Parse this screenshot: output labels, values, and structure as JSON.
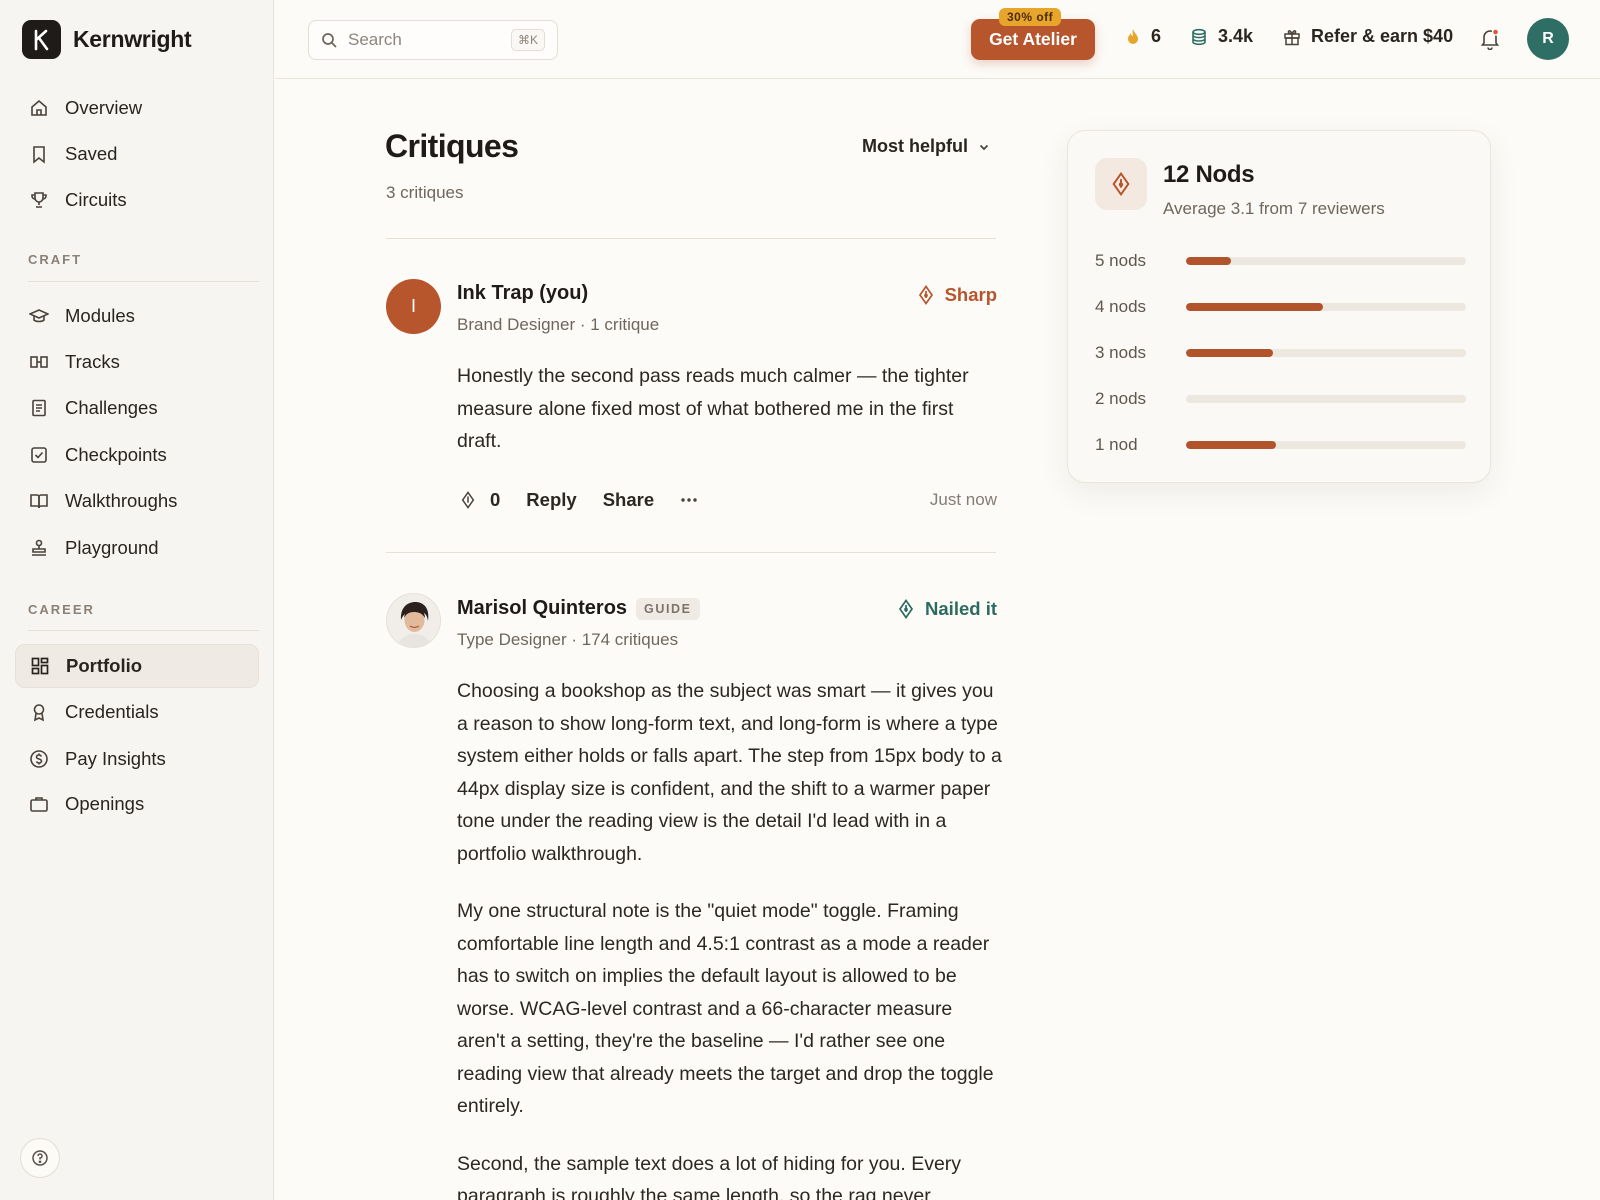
{
  "brand": {
    "name": "Kernwright",
    "logo_letter": "K"
  },
  "sidebar": {
    "top_items": [
      {
        "label": "Overview",
        "icon": "home-icon"
      },
      {
        "label": "Saved",
        "icon": "bookmark-icon"
      },
      {
        "label": "Circuits",
        "icon": "trophy-icon"
      }
    ],
    "sections": [
      {
        "title": "CRAFT",
        "items": [
          {
            "label": "Modules",
            "icon": "graduation-cap-icon"
          },
          {
            "label": "Tracks",
            "icon": "tracks-icon"
          },
          {
            "label": "Challenges",
            "icon": "document-icon"
          },
          {
            "label": "Checkpoints",
            "icon": "checkbox-icon"
          },
          {
            "label": "Walkthroughs",
            "icon": "book-open-icon"
          },
          {
            "label": "Playground",
            "icon": "stamp-icon"
          }
        ]
      },
      {
        "title": "CAREER",
        "items": [
          {
            "label": "Portfolio",
            "icon": "grid-icon",
            "active": true
          },
          {
            "label": "Credentials",
            "icon": "award-icon"
          },
          {
            "label": "Pay Insights",
            "icon": "dollar-icon"
          },
          {
            "label": "Openings",
            "icon": "briefcase-icon"
          }
        ]
      }
    ]
  },
  "topbar": {
    "search_placeholder": "Search",
    "search_shortcut": "⌘K",
    "cta_badge": "30% off",
    "cta_label": "Get Atelier",
    "streak": "6",
    "coins": "3.4k",
    "refer": "Refer & earn $40",
    "avatar_initial": "R"
  },
  "main": {
    "title": "Critiques",
    "count": "3 critiques",
    "sort_label": "Most helpful"
  },
  "critiques": [
    {
      "author": "Ink Trap (you)",
      "avatar_initial": "I",
      "meta": "Brand Designer · 1 critique",
      "tag": "Sharp",
      "tag_color": "#b7552d",
      "body": [
        "Honestly the second pass reads much calmer — the tighter measure alone fixed most of what bothered me in the first draft."
      ],
      "nods": "0",
      "reply": "Reply",
      "share": "Share",
      "time": "Just now"
    },
    {
      "author": "Marisol Quinteros",
      "badge": "GUIDE",
      "meta": "Type Designer · 174 critiques",
      "tag": "Nailed it",
      "tag_color": "#2d6b5f",
      "body": [
        "Choosing a bookshop as the subject was smart — it gives you a reason to show long-form text, and long-form is where a type system either holds or falls apart. The step from 15px body to a 44px display size is confident, and the shift to a warmer paper tone under the reading view is the detail I'd lead with in a portfolio walkthrough.",
        "My one structural note is the \"quiet mode\" toggle. Framing comfortable line length and 4.5:1 contrast as a mode a reader has to switch on implies the default layout is allowed to be worse. WCAG-level contrast and a 66-character measure aren't a setting, they're the baseline — I'd rather see one reading view that already meets the target and drop the toggle entirely.",
        "Second, the sample text does a lot of hiding for you. Every paragraph is roughly the same length, so the rag never"
      ]
    }
  ],
  "nods_summary": {
    "title": "12 Nods",
    "subtitle": "Average 3.1 from 7 reviewers",
    "distribution": [
      {
        "label": "5 nods",
        "fraction": 0.16
      },
      {
        "label": "4 nods",
        "fraction": 0.49
      },
      {
        "label": "3 nods",
        "fraction": 0.31
      },
      {
        "label": "2 nods",
        "fraction": 0.0
      },
      {
        "label": "1 nod",
        "fraction": 0.32
      }
    ]
  },
  "colors": {
    "accent": "#b7552d",
    "guide_green": "#2d6b5f",
    "avatar_green": "#2f6e64",
    "badge_gold": "#e7a62b"
  }
}
